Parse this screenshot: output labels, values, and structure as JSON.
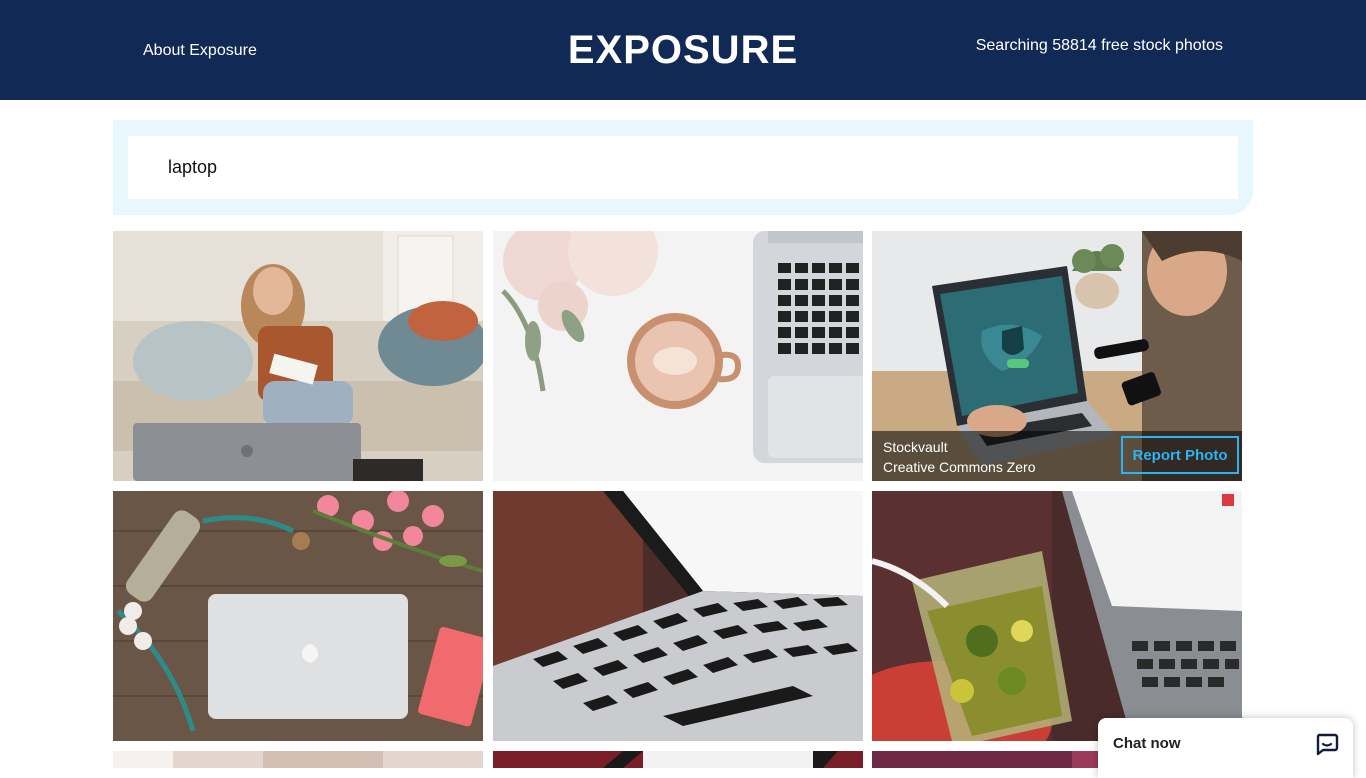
{
  "header": {
    "about_label": "About Exposure",
    "logo": "EXPOSURE",
    "photo_count_text": "Searching 58814 free stock photos"
  },
  "search": {
    "value": "laptop"
  },
  "photos": [
    {
      "subject": "woman writing in notebook on sofa with laptop"
    },
    {
      "subject": "latte cup beside laptop keyboard and flowers"
    },
    {
      "subject": "man using laptop with vpn map on screen",
      "source": "Stockvault",
      "license": "Creative Commons Zero",
      "report_label": "Report Photo"
    },
    {
      "subject": "closed laptop flat lay with pink flowers and notebook"
    },
    {
      "subject": "close-up of laptop keyboard"
    },
    {
      "subject": "mojito glass next to laptop"
    }
  ],
  "chat": {
    "label": "Chat now",
    "icon": "chat-bubble-icon"
  },
  "colors": {
    "header_bg": "#112a55",
    "search_frame": "#e8f7fd",
    "accent": "#2bb3f5"
  }
}
